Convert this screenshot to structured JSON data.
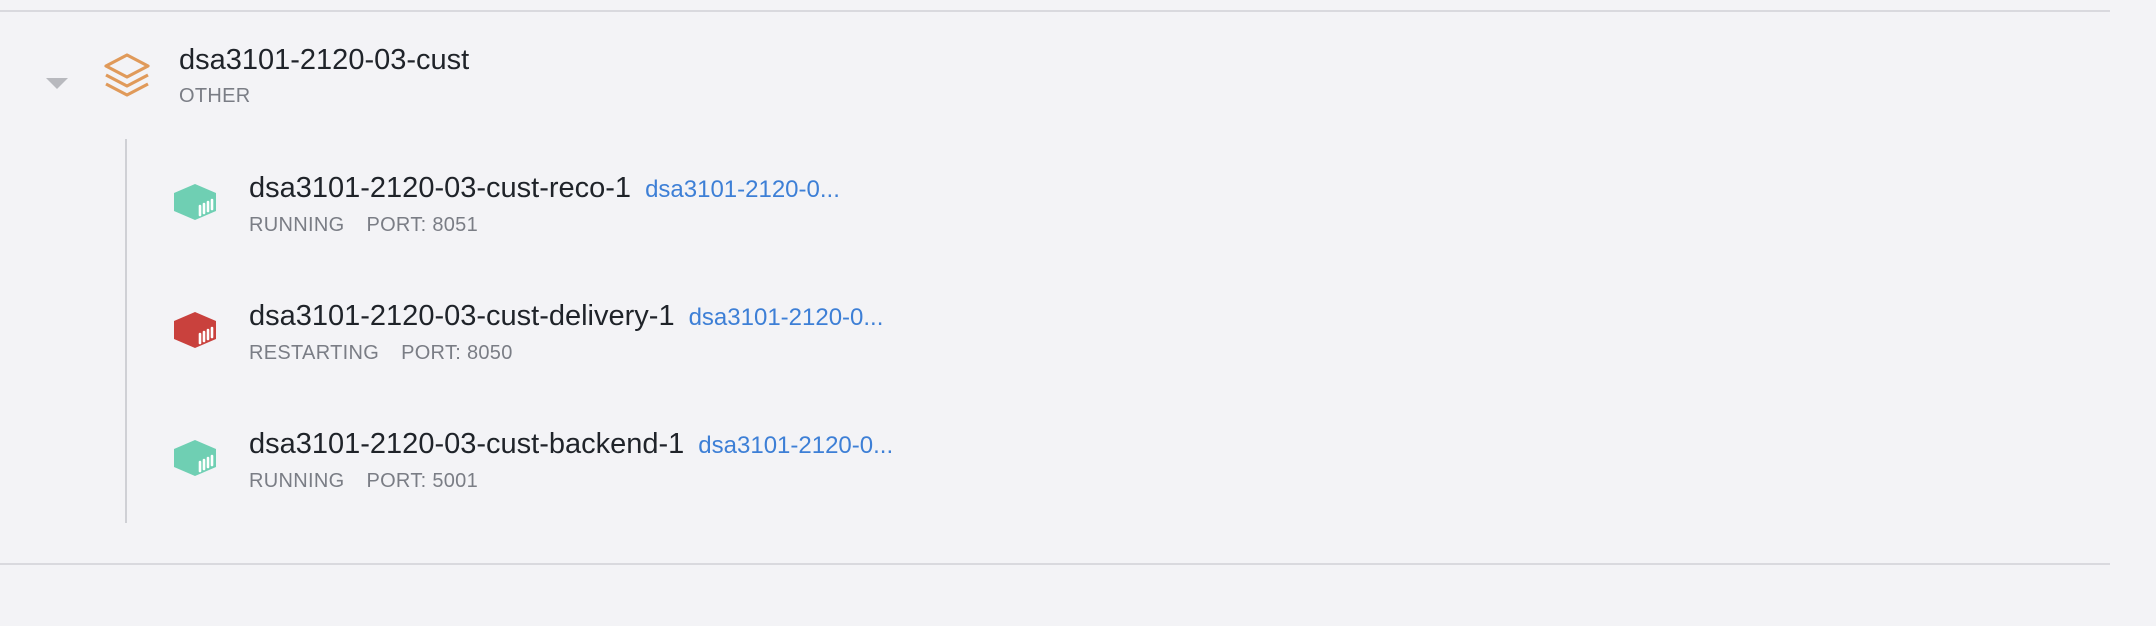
{
  "stack": {
    "name": "dsa3101-2120-03-cust",
    "type": "OTHER",
    "icon": "stack-layers-icon",
    "icon_color": "#e09a5a"
  },
  "containers": [
    {
      "name": "dsa3101-2120-03-cust-reco-1",
      "image": "dsa3101-2120-0...",
      "status": "RUNNING",
      "port": "PORT: 8051",
      "icon": "container-icon",
      "color": "#6fcfb3"
    },
    {
      "name": "dsa3101-2120-03-cust-delivery-1",
      "image": "dsa3101-2120-0...",
      "status": "RESTARTING",
      "port": "PORT: 8050",
      "icon": "container-icon",
      "color": "#c9413d"
    },
    {
      "name": "dsa3101-2120-03-cust-backend-1",
      "image": "dsa3101-2120-0...",
      "status": "RUNNING",
      "port": "PORT: 5001",
      "icon": "container-icon",
      "color": "#6fcfb3"
    }
  ]
}
